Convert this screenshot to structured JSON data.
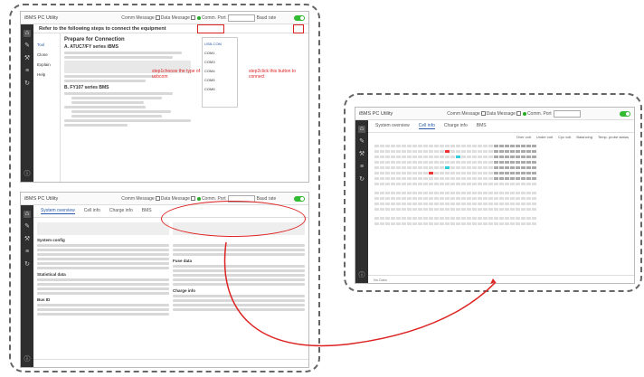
{
  "app_title": "iBMS PC Utility",
  "titlebar": {
    "comm_message": "Comm Message",
    "data_message": "Data Message",
    "comm_port": "Comm. Port",
    "baud_rate": "Baud rate"
  },
  "main_panel": {
    "sidebar": [
      "home-icon",
      "edit-icon",
      "wrench-icon",
      "list-icon",
      "refresh-icon"
    ],
    "instructions_heading": "Refer to the following steps to connect the equipment",
    "left_tabs": [
      "Tool",
      "Clone",
      "Explain",
      "Help"
    ],
    "prepare_title": "Prepare for Connection",
    "step_a": "A. ATUC7/FY series iBMS",
    "step_b": "B. FY107 series BMS",
    "dropdown_options": [
      "USB-COM",
      "COM1",
      "COM3",
      "COM4",
      "COM5",
      "COM6"
    ],
    "annotation_step1": "step1choose the type of usbcom",
    "annotation_step2": "step2click this button to connect"
  },
  "second_panel": {
    "tabs": [
      "System overview",
      "Cell info",
      "Charge info",
      "BMS"
    ],
    "section_labels": [
      "System config",
      "Statistical data",
      "Bus ID"
    ],
    "right_labels": [
      "Fuse data",
      "Charge info"
    ]
  },
  "third_panel": {
    "tabs": [
      "System overview",
      "Cell info",
      "Charge info",
      "BMS"
    ],
    "legend": [
      "Over volt",
      "Under volt",
      "Cyc volt",
      "Balancing",
      "Temp. probe status"
    ],
    "footer_text": "No Data"
  },
  "colors": {
    "accent": "#2a5aa8",
    "toggle": "#33bb33",
    "highlight_red": "#ee3333",
    "highlight_cyan": "#33ccdd",
    "annotation": "#dd2222"
  }
}
